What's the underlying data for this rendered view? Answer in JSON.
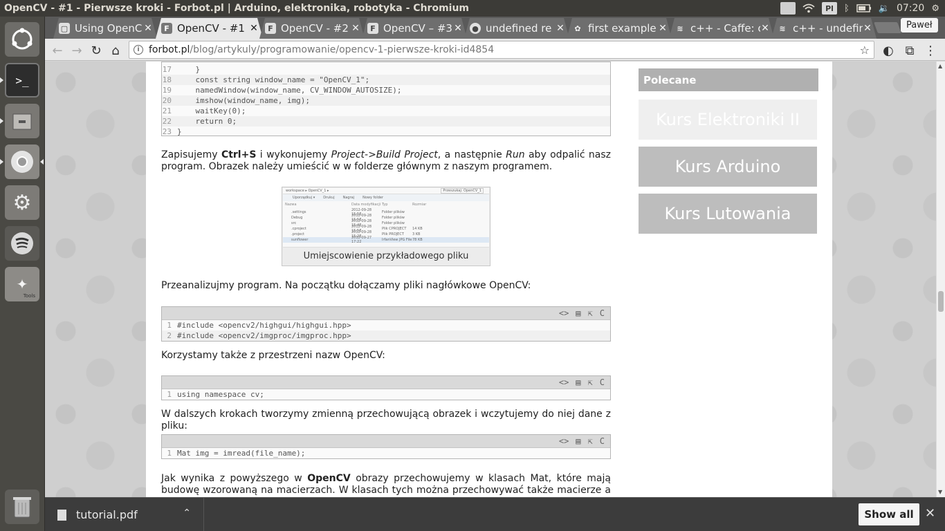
{
  "window": {
    "title": "OpenCV - #1 - Pierwsze kroki - Forbot.pl | Arduino, elektronika, robotyka - Chromium"
  },
  "top_panel": {
    "indicator_lang": "Pl",
    "clock": "07:20"
  },
  "launcher": {
    "items": [
      {
        "name": "ubuntu-dash-icon"
      },
      {
        "name": "terminal-icon"
      },
      {
        "name": "files-icon"
      },
      {
        "name": "chromium-icon"
      },
      {
        "name": "system-settings-icon"
      },
      {
        "name": "spotify-icon"
      },
      {
        "name": "opencv-tools-icon",
        "label": "Tools"
      },
      {
        "name": "trash-icon"
      }
    ]
  },
  "tabs": [
    {
      "label": "Using OpenC",
      "favicon": "page",
      "active": false
    },
    {
      "label": "OpenCV - #1",
      "favicon": "F",
      "active": true
    },
    {
      "label": "OpenCV - #2",
      "favicon": "F",
      "active": false
    },
    {
      "label": "OpenCV – #3",
      "favicon": "F",
      "active": false
    },
    {
      "label": "undefined re",
      "favicon": "github",
      "active": false
    },
    {
      "label": "first example",
      "favicon": "caffe",
      "active": false
    },
    {
      "label": "c++ - Caffe: c",
      "favicon": "so",
      "active": false
    },
    {
      "label": "c++ - undefin",
      "favicon": "so",
      "active": false
    }
  ],
  "profile_name": "Paweł",
  "omnibox": {
    "host": "forbot.pl",
    "path": "/blog/artykuly/programowanie/opencv-1-pierwsze-kroki-id4854"
  },
  "code_top": {
    "lines": [
      {
        "n": "17",
        "text": "    }"
      },
      {
        "n": "18",
        "text": "    const string window_name = \"OpenCV_1\";"
      },
      {
        "n": "19",
        "text": "    namedWindow(window_name, CV_WINDOW_AUTOSIZE);"
      },
      {
        "n": "20",
        "text": "    imshow(window_name, img);"
      },
      {
        "n": "21",
        "text": "    waitKey(0);"
      },
      {
        "n": "22",
        "text": "    return 0;"
      },
      {
        "n": "23",
        "text": "}"
      }
    ]
  },
  "article": {
    "p1_a": "Zapisujemy ",
    "p1_b": "Ctrl+S",
    "p1_c": " i wykonujemy ",
    "p1_d": "Project->Build Project",
    "p1_e": ", a następnie ",
    "p1_f": "Run",
    "p1_g": " aby odpalić nasz program. Obrazek należy umieścić w w folderze głównym z naszym programem.",
    "figure_caption": "Umiejscowienie przykładowego pliku",
    "p2": "Przeanalizujmy program. Na początku dołączamy pliki nagłówkowe OpenCV:",
    "p3": "Korzystamy także z przestrzeni nazw OpenCV:",
    "p4": "W dalszych krokach tworzymy zmienną przechowującą obrazek i wczytujemy do niej dane z pliku:",
    "p5_a": "Jak wynika z powyższego w ",
    "p5_b": "OpenCV",
    "p5_c": " obrazy przechowujemy w klasach Mat, które mają budowę wzorowaną na macierzach. W klasach tych można przechowywać także macierze a OpenCV"
  },
  "code_includes": {
    "lines": [
      {
        "n": "1",
        "text": "#include <opencv2/highgui/highgui.hpp>"
      },
      {
        "n": "2",
        "text": "#include <opencv2/imgproc/imgproc.hpp>"
      }
    ]
  },
  "code_namespace": {
    "lines": [
      {
        "n": "1",
        "text": "using namespace cv;"
      }
    ]
  },
  "code_mat": {
    "lines": [
      {
        "n": "1",
        "text": "Mat img = imread(file_name);"
      }
    ]
  },
  "code_toolbar": {
    "c_label": "C"
  },
  "sidebar": {
    "heading": "Polecane",
    "buttons": [
      {
        "label": "Kurs Elektroniki II"
      },
      {
        "label": "Kurs Arduino"
      },
      {
        "label": "Kurs Lutowania"
      }
    ]
  },
  "figure_screenshot": {
    "path_text": "workspace ▸ OpenCV_1 ▸",
    "search_text": "Przeszukaj: OpenCV_1",
    "toolbar": [
      "Uporządkuj ▾",
      "Drukuj",
      "Nagraj",
      "Nowy folder"
    ],
    "columns": [
      "Nazwa",
      "Data modyfikacji",
      "Typ",
      "Rozmiar"
    ],
    "rows": [
      [
        ".settings",
        "2012-09-28 15:58",
        "Folder plików",
        ""
      ],
      [
        "Debug",
        "2012-09-28 15:58",
        "Folder plików",
        ""
      ],
      [
        "src",
        "2012-09-28 15:48",
        "Folder plików",
        ""
      ],
      [
        ".cproject",
        "2012-09-28 15:58",
        "Plik CPROJECT",
        "14 KB"
      ],
      [
        ".project",
        "2012-09-28 15:28",
        "Plik PROJECT",
        "3 KB"
      ],
      [
        "sunflower",
        "2012-09-27 17:22",
        "IrfanView JPG File",
        "78 KB"
      ]
    ]
  },
  "download_shelf": {
    "file": "tutorial.pdf",
    "show_all": "Show all"
  }
}
